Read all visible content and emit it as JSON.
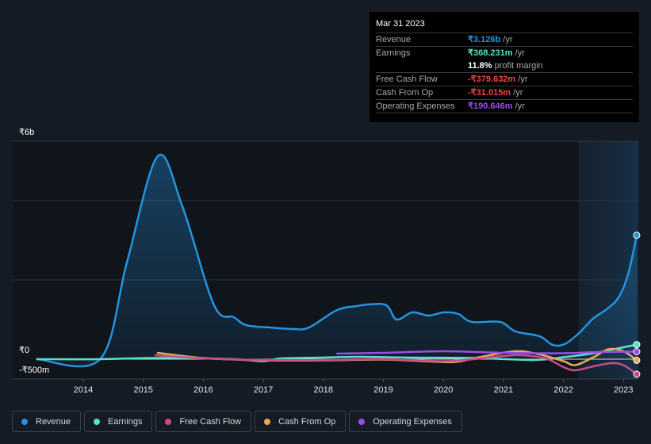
{
  "chart_data": {
    "type": "line",
    "title": "",
    "xlabel": "",
    "ylabel": "",
    "x_unit": "year",
    "y_unit": "INR billions",
    "ylim": [
      -0.5,
      5.5
    ],
    "xlim": [
      2013.23,
      2023.25
    ],
    "y_tick_labels": [
      {
        "value": 5.5,
        "label": "₹6b"
      },
      {
        "value": 0,
        "label": "₹0"
      },
      {
        "value": -0.5,
        "label": "-₹500m"
      }
    ],
    "y_gridlines": [
      5.5,
      4,
      2
    ],
    "x_ticks": [
      2014,
      2015,
      2016,
      2017,
      2018,
      2019,
      2020,
      2021,
      2022,
      2023
    ],
    "x_tick_labels": [
      "2014",
      "2015",
      "2016",
      "2017",
      "2018",
      "2019",
      "2020",
      "2021",
      "2022",
      "2023"
    ],
    "highlight_range": [
      2022.25,
      2023.25
    ],
    "legend_position": "bottom-left",
    "series": [
      {
        "name": "Revenue",
        "color": "#2394df",
        "filled": true,
        "points": [
          [
            2013.23,
            0
          ],
          [
            2014.28,
            0
          ],
          [
            2014.73,
            2.46
          ],
          [
            2015.24,
            5.12
          ],
          [
            2015.65,
            3.86
          ],
          [
            2016.18,
            1.36
          ],
          [
            2016.51,
            1.06
          ],
          [
            2016.71,
            0.86
          ],
          [
            2017.1,
            0.8
          ],
          [
            2017.5,
            0.76
          ],
          [
            2017.76,
            0.8
          ],
          [
            2018.23,
            1.24
          ],
          [
            2018.56,
            1.34
          ],
          [
            2018.76,
            1.38
          ],
          [
            2019.05,
            1.36
          ],
          [
            2019.22,
            1.0
          ],
          [
            2019.48,
            1.18
          ],
          [
            2019.75,
            1.1
          ],
          [
            2020.01,
            1.18
          ],
          [
            2020.25,
            1.14
          ],
          [
            2020.47,
            0.94
          ],
          [
            2020.94,
            0.94
          ],
          [
            2021.2,
            0.7
          ],
          [
            2021.6,
            0.58
          ],
          [
            2021.82,
            0.36
          ],
          [
            2022.02,
            0.38
          ],
          [
            2022.26,
            0.66
          ],
          [
            2022.49,
            1.02
          ],
          [
            2022.72,
            1.26
          ],
          [
            2022.92,
            1.56
          ],
          [
            2023.08,
            2.16
          ],
          [
            2023.22,
            3.126
          ]
        ]
      },
      {
        "name": "Earnings",
        "color": "#58e1c8",
        "filled": false,
        "points": [
          [
            2013.23,
            0
          ],
          [
            2014.28,
            0
          ],
          [
            2015.2,
            0.03
          ],
          [
            2016.5,
            0.0
          ],
          [
            2017.0,
            -0.05
          ],
          [
            2017.3,
            0.02
          ],
          [
            2018.0,
            0.04
          ],
          [
            2018.6,
            0.06
          ],
          [
            2019.5,
            0.04
          ],
          [
            2020.5,
            0.03
          ],
          [
            2021.5,
            -0.02
          ],
          [
            2022.0,
            0.05
          ],
          [
            2022.5,
            0.15
          ],
          [
            2023.0,
            0.3
          ],
          [
            2023.22,
            0.368
          ]
        ]
      },
      {
        "name": "Free Cash Flow",
        "color": "#c84a8a",
        "filled": false,
        "points": [
          [
            2015.2,
            0.1
          ],
          [
            2016.0,
            0.02
          ],
          [
            2017.0,
            -0.02
          ],
          [
            2018.0,
            -0.02
          ],
          [
            2019.0,
            0.0
          ],
          [
            2020.0,
            -0.05
          ],
          [
            2020.5,
            0.0
          ],
          [
            2021.2,
            0.1
          ],
          [
            2021.7,
            0.02
          ],
          [
            2022.0,
            -0.2
          ],
          [
            2022.2,
            -0.28
          ],
          [
            2022.5,
            -0.18
          ],
          [
            2022.8,
            -0.1
          ],
          [
            2023.0,
            -0.15
          ],
          [
            2023.22,
            -0.38
          ]
        ]
      },
      {
        "name": "Cash From Op",
        "color": "#e8a95b",
        "filled": false,
        "points": [
          [
            2015.24,
            0.16
          ],
          [
            2016.0,
            0.03
          ],
          [
            2017.0,
            -0.03
          ],
          [
            2018.0,
            -0.03
          ],
          [
            2019.0,
            -0.01
          ],
          [
            2019.8,
            -0.06
          ],
          [
            2020.2,
            -0.07
          ],
          [
            2020.6,
            0.05
          ],
          [
            2021.2,
            0.2
          ],
          [
            2021.6,
            0.12
          ],
          [
            2022.0,
            -0.05
          ],
          [
            2022.2,
            -0.15
          ],
          [
            2022.5,
            0.05
          ],
          [
            2022.75,
            0.25
          ],
          [
            2023.0,
            0.2
          ],
          [
            2023.22,
            -0.03
          ]
        ]
      },
      {
        "name": "Operating Expenses",
        "color": "#9b4ee6",
        "filled": false,
        "points": [
          [
            2018.23,
            0.14
          ],
          [
            2019.0,
            0.16
          ],
          [
            2020.0,
            0.2
          ],
          [
            2021.0,
            0.16
          ],
          [
            2022.0,
            0.15
          ],
          [
            2022.6,
            0.18
          ],
          [
            2023.22,
            0.19
          ]
        ]
      }
    ]
  },
  "tooltip": {
    "date": "Mar 31 2023",
    "rows": [
      {
        "label": "Revenue",
        "value": "₹3.126b",
        "unit": " /yr",
        "color": "#2394df"
      },
      {
        "label": "Earnings",
        "value": "₹368.231m",
        "unit": " /yr",
        "color": "#58e1c8"
      },
      {
        "label": "",
        "value": "11.8%",
        "unit": " profit margin",
        "color": "#ffffff"
      },
      {
        "label": "Free Cash Flow",
        "value": "-₹379.632m",
        "unit": " /yr",
        "color": "#f04646"
      },
      {
        "label": "Cash From Op",
        "value": "-₹31.015m",
        "unit": " /yr",
        "color": "#f04646"
      },
      {
        "label": "Operating Expenses",
        "value": "₹190.646m",
        "unit": " /yr",
        "color": "#9b4ee6"
      }
    ]
  },
  "legend": [
    {
      "label": "Revenue",
      "color": "#2394df"
    },
    {
      "label": "Earnings",
      "color": "#58e1c8"
    },
    {
      "label": "Free Cash Flow",
      "color": "#c84a8a"
    },
    {
      "label": "Cash From Op",
      "color": "#e8a95b"
    },
    {
      "label": "Operating Expenses",
      "color": "#9b4ee6"
    }
  ]
}
